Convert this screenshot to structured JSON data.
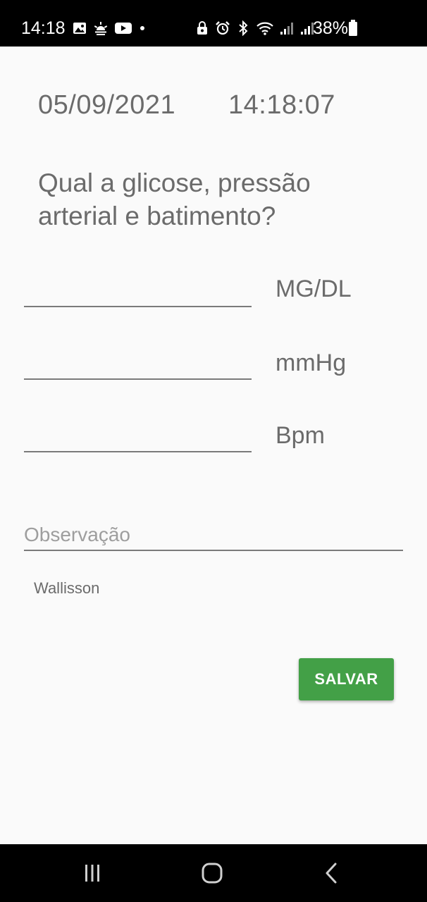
{
  "status_bar": {
    "time": "14:18",
    "left_icons": [
      "gallery-icon",
      "weather-icon",
      "youtube-icon",
      "notification-dot-icon"
    ],
    "right_icons": [
      "lock-icon",
      "alarm-icon",
      "bluetooth-icon",
      "wifi-icon",
      "signal-icon",
      "signal-icon"
    ],
    "battery_percent": "38%"
  },
  "header": {
    "date": "05/09/2021",
    "time": "14:18:07"
  },
  "question": "Qual a glicose, pressão arterial e batimento?",
  "fields": {
    "glucose": {
      "value": "",
      "unit": "MG/DL"
    },
    "pressure": {
      "value": "",
      "unit": "mmHg"
    },
    "heart_rate": {
      "value": "",
      "unit": "Bpm"
    }
  },
  "observation": {
    "placeholder": "Observação",
    "value": ""
  },
  "user_name": "Wallisson",
  "save_button": {
    "label": "SALVAR",
    "color": "#43a047"
  },
  "nav_bar": {
    "buttons": [
      "recent-apps-icon",
      "home-icon",
      "back-icon"
    ]
  }
}
